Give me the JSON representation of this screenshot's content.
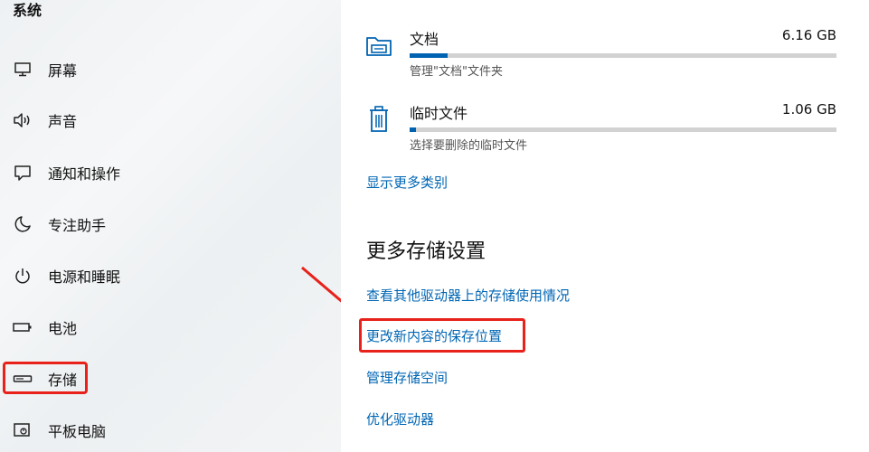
{
  "sidebar": {
    "title": "系统",
    "items": [
      {
        "label": "屏幕",
        "icon": "monitor-icon"
      },
      {
        "label": "声音",
        "icon": "speaker-icon"
      },
      {
        "label": "通知和操作",
        "icon": "notification-icon"
      },
      {
        "label": "专注助手",
        "icon": "moon-icon"
      },
      {
        "label": "电源和睡眠",
        "icon": "power-icon"
      },
      {
        "label": "电池",
        "icon": "battery-icon"
      },
      {
        "label": "存储",
        "icon": "storage-icon",
        "selected": true
      },
      {
        "label": "平板电脑",
        "icon": "tablet-icon"
      }
    ]
  },
  "main": {
    "categories": [
      {
        "name": "文档",
        "size": "6.16 GB",
        "subtitle": "管理\"文档\"文件夹",
        "usage_fraction": 0.09,
        "icon": "folder-icon"
      },
      {
        "name": "临时文件",
        "size": "1.06 GB",
        "subtitle": "选择要删除的临时文件",
        "usage_fraction": 0.015,
        "icon": "trash-icon"
      }
    ],
    "show_more": "显示更多类别",
    "more_settings_title": "更多存储设置",
    "links": [
      "查看其他驱动器上的存储使用情况",
      "更改新内容的保存位置",
      "管理存储空间",
      "优化驱动器"
    ]
  },
  "colors": {
    "accent": "#0063b1",
    "link": "#0066b4",
    "annotation": "#e8211a"
  }
}
